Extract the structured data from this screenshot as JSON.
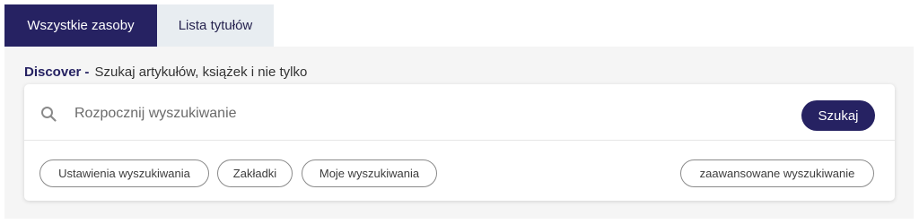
{
  "tabs": [
    {
      "label": "Wszystkie zasoby",
      "active": true
    },
    {
      "label": "Lista tytułów",
      "active": false
    }
  ],
  "heading": {
    "brand": "Discover",
    "separator": "-",
    "subtitle": "Szukaj artykułów, książek i nie tylko"
  },
  "search": {
    "icon": "search-icon",
    "placeholder": "Rozpocznij wyszukiwanie",
    "value": "",
    "button_label": "Szukaj"
  },
  "links": {
    "settings": "Ustawienia wyszukiwania",
    "bookmarks": "Zakładki",
    "my_searches": "Moje wyszukiwania",
    "advanced": "zaawansowane wyszukiwanie"
  },
  "colors": {
    "primary": "#262262",
    "tab_inactive_bg": "#e8edf1",
    "panel_bg": "#f5f5f5"
  }
}
